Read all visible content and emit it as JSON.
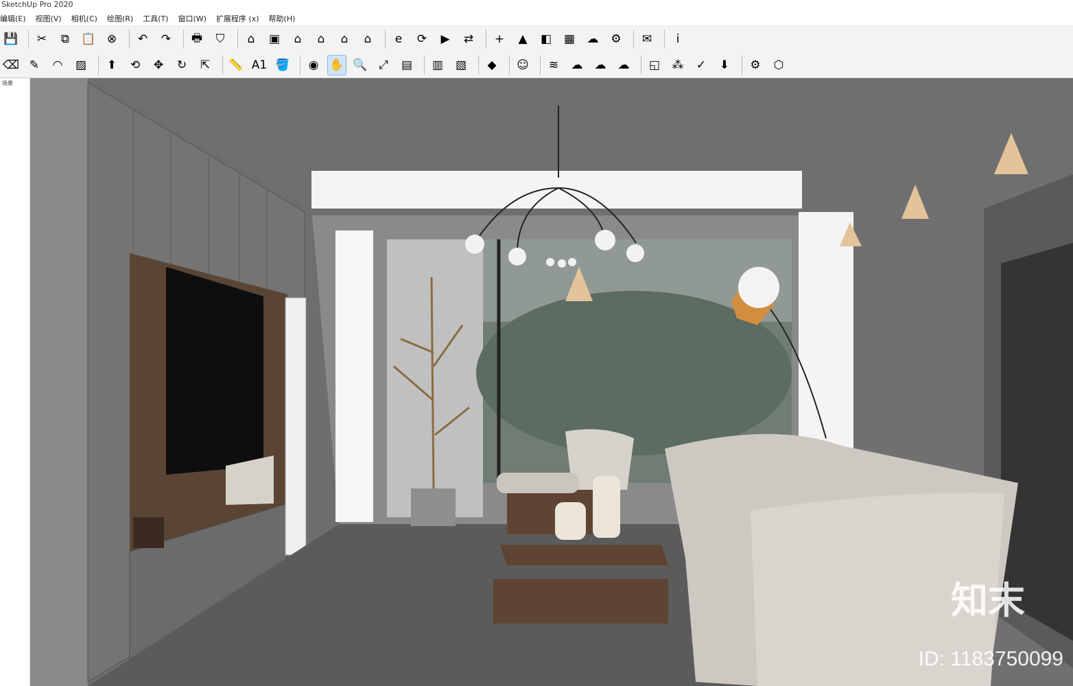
{
  "app": {
    "title": "SketchUp Pro 2020"
  },
  "menu": [
    "编辑(E)",
    "视图(V)",
    "相机(C)",
    "绘图(R)",
    "工具(T)",
    "窗口(W)",
    "扩展程序 (x)",
    "帮助(H)"
  ],
  "scene_tab": "场景",
  "toolbar1": [
    {
      "name": "save-icon",
      "glyph": "💾"
    },
    {
      "name": "cut-icon",
      "glyph": "✂"
    },
    {
      "name": "copy-icon",
      "glyph": "⧉"
    },
    {
      "name": "paste-icon",
      "glyph": "📋"
    },
    {
      "name": "erase-icon",
      "glyph": "⊗"
    },
    {
      "name": "undo-icon",
      "glyph": "↶"
    },
    {
      "name": "redo-icon",
      "glyph": "↷"
    },
    {
      "name": "print-icon",
      "glyph": "🖶"
    },
    {
      "name": "model-info-icon",
      "glyph": "⛉"
    },
    {
      "name": "iso-view-icon",
      "glyph": "⌂"
    },
    {
      "name": "top-view-icon",
      "glyph": "▣"
    },
    {
      "name": "front-view-icon",
      "glyph": "⌂"
    },
    {
      "name": "right-view-icon",
      "glyph": "⌂"
    },
    {
      "name": "back-view-icon",
      "glyph": "⌂"
    },
    {
      "name": "left-view-icon",
      "glyph": "⌂"
    },
    {
      "name": "extension-icon",
      "glyph": "e"
    },
    {
      "name": "refresh-icon",
      "glyph": "⟳"
    },
    {
      "name": "camera-icon",
      "glyph": "▶"
    },
    {
      "name": "arrows-icon",
      "glyph": "⇄"
    },
    {
      "name": "add-icon",
      "glyph": "+"
    },
    {
      "name": "warehouse-icon",
      "glyph": "▲"
    },
    {
      "name": "layout-icon",
      "glyph": "◧"
    },
    {
      "name": "checker-icon",
      "glyph": "▦"
    },
    {
      "name": "upload-icon",
      "glyph": "☁"
    },
    {
      "name": "settings-icon",
      "glyph": "⚙"
    },
    {
      "name": "mail-icon",
      "glyph": "✉"
    },
    {
      "name": "info-icon",
      "glyph": "i"
    }
  ],
  "toolbar2": [
    {
      "name": "eraser-tool-icon",
      "glyph": "⌫"
    },
    {
      "name": "pencil-icon",
      "glyph": "✎"
    },
    {
      "name": "arc-icon",
      "glyph": "◠"
    },
    {
      "name": "rectangle-icon",
      "glyph": "▨"
    },
    {
      "name": "push-pull-icon",
      "glyph": "⬆"
    },
    {
      "name": "offset-icon",
      "glyph": "⟲"
    },
    {
      "name": "move-icon",
      "glyph": "✥"
    },
    {
      "name": "rotate-icon",
      "glyph": "↻"
    },
    {
      "name": "scale-icon",
      "glyph": "⇱"
    },
    {
      "name": "tape-icon",
      "glyph": "📏"
    },
    {
      "name": "text-icon",
      "glyph": "A1"
    },
    {
      "name": "paint-icon",
      "glyph": "🪣"
    },
    {
      "name": "orbit-icon",
      "glyph": "◉"
    },
    {
      "name": "pan-icon",
      "glyph": "✋"
    },
    {
      "name": "zoom-icon",
      "glyph": "🔍"
    },
    {
      "name": "zoom-extents-icon",
      "glyph": "⤢"
    },
    {
      "name": "section-icon",
      "glyph": "▤"
    },
    {
      "name": "section-display-icon",
      "glyph": "▥"
    },
    {
      "name": "section-cut-icon",
      "glyph": "▧"
    },
    {
      "name": "ruby-icon",
      "glyph": "◆"
    },
    {
      "name": "user-icon",
      "glyph": "☺"
    },
    {
      "name": "sandbox-icon",
      "glyph": "≋"
    },
    {
      "name": "smoove-icon",
      "glyph": "☁"
    },
    {
      "name": "stamp-icon",
      "glyph": "☁"
    },
    {
      "name": "drape-icon",
      "glyph": "☁"
    },
    {
      "name": "frame-icon",
      "glyph": "◱"
    },
    {
      "name": "dots-icon",
      "glyph": "⁂"
    },
    {
      "name": "check-icon",
      "glyph": "✓"
    },
    {
      "name": "download-icon",
      "glyph": "⬇"
    },
    {
      "name": "gear2-icon",
      "glyph": "⚙"
    },
    {
      "name": "cube-icon",
      "glyph": "⬡"
    }
  ],
  "watermark": {
    "logo": "知末",
    "id": "ID: 1183750099"
  }
}
